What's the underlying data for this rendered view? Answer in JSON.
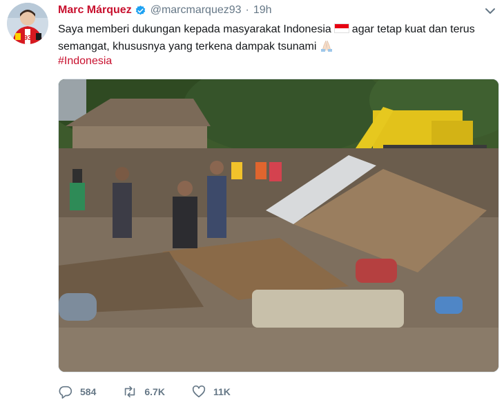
{
  "author": {
    "name": "Marc Márquez",
    "handle": "@marcmarquez93",
    "separator": "·",
    "time": "19h",
    "avatar_icon": "rider-avatar",
    "verified_icon": "verified-badge-icon"
  },
  "tweet": {
    "text_part1": "Saya memberi dukungan kepada masyarakat Indonesia",
    "text_part2": "agar tetap kuat dan terus semangat, khususnya yang terkena dampak tsunami",
    "flag_icon": "indonesia-flag-emoji",
    "pray_icon": "folded-hands-emoji",
    "hashtag": "#Indonesia"
  },
  "media": {
    "icon": "tsunami-aftermath-photo"
  },
  "actions": {
    "replies": "584",
    "retweets": "6.7K",
    "likes": "11K"
  },
  "colors": {
    "name": "#c8102e",
    "hashtag": "#c8102e",
    "muted": "#657786",
    "verified": "#1da1f2"
  }
}
